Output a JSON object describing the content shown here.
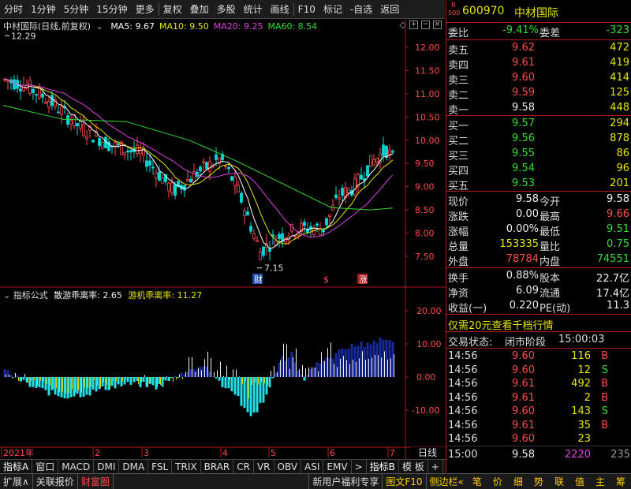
{
  "toolbar": {
    "items": [
      "分时",
      "1分钟",
      "5分钟",
      "15分钟",
      "更多",
      "复权",
      "叠加",
      "多股",
      "统计",
      "画线",
      "F10",
      "标记",
      "-自选",
      "返回"
    ]
  },
  "chart": {
    "title": "中材国际(日线,前复权)",
    "ma": [
      {
        "label": "MA5: 9.67",
        "color": "#ffffff"
      },
      {
        "label": "MA10: 9.50",
        "color": "#e6e600"
      },
      {
        "label": "MA20: 9.25",
        "color": "#e040e0"
      },
      {
        "label": "MA60: 8.54",
        "color": "#33dd33"
      }
    ],
    "high_marker": "12.29",
    "low_marker": "7.15",
    "price_axis": [
      "12.00",
      "11.50",
      "11.00",
      "10.50",
      "10.00",
      "9.50",
      "9.00",
      "8.50",
      "8.00",
      "7.50"
    ],
    "events": [
      "财",
      "$",
      "涨"
    ]
  },
  "indicator": {
    "name": "指标公式",
    "line1": "散游乖离率: 2.65",
    "line2": "游机乖离率: 11.27",
    "axis": [
      "20.00",
      "10.00",
      "0.00",
      "-10.00"
    ]
  },
  "x_axis": {
    "labels": [
      "2021年",
      "2",
      "3",
      "4",
      "5",
      "6",
      "7"
    ],
    "period": "日线"
  },
  "tabs": [
    "指标A",
    "窗口",
    "MACD",
    "DMI",
    "DMA",
    "FSL",
    "TRIX",
    "BRAR",
    "CR",
    "VR",
    "OBV",
    "ASI",
    "EMV",
    ">",
    "指标B",
    "模 板",
    "+",
    "-"
  ],
  "status_bar": {
    "left": [
      "扩展∧",
      "关联报价",
      "财富圈"
    ],
    "right": [
      "新用户福利专享",
      "图文F10",
      "侧边栏«"
    ],
    "icons": [
      "笔",
      "价",
      "细",
      "势",
      "联",
      "值",
      "主",
      "筹"
    ]
  },
  "quote": {
    "code": "600970",
    "name": "中材国际",
    "badge_top": "R",
    "badge_bottom": "500",
    "webi_label": "委比",
    "webi": "-9.41%",
    "weicha_label": "委差",
    "weicha": "-323",
    "asks": [
      {
        "label": "卖五",
        "price": "9.62",
        "vol": "472"
      },
      {
        "label": "卖四",
        "price": "9.61",
        "vol": "419"
      },
      {
        "label": "卖三",
        "price": "9.60",
        "vol": "414"
      },
      {
        "label": "卖二",
        "price": "9.59",
        "vol": "125"
      },
      {
        "label": "卖一",
        "price": "9.58",
        "vol": "448"
      }
    ],
    "bids": [
      {
        "label": "买一",
        "price": "9.57",
        "vol": "294"
      },
      {
        "label": "买二",
        "price": "9.56",
        "vol": "878"
      },
      {
        "label": "买三",
        "price": "9.55",
        "vol": "86"
      },
      {
        "label": "买四",
        "price": "9.54",
        "vol": "96"
      },
      {
        "label": "买五",
        "price": "9.53",
        "vol": "201"
      }
    ],
    "stats": [
      {
        "l1": "现价",
        "v1": "9.58",
        "c1": "white",
        "l2": "今开",
        "v2": "9.58",
        "c2": "white"
      },
      {
        "l1": "涨跌",
        "v1": "0.00",
        "c1": "white",
        "l2": "最高",
        "v2": "9.66",
        "c2": "red"
      },
      {
        "l1": "涨幅",
        "v1": "0.00%",
        "c1": "white",
        "l2": "最低",
        "v2": "9.51",
        "c2": "green"
      },
      {
        "l1": "总量",
        "v1": "153335",
        "c1": "yellow",
        "l2": "量比",
        "v2": "0.75",
        "c2": "green"
      },
      {
        "l1": "外盘",
        "v1": "78784",
        "c1": "red",
        "l2": "内盘",
        "v2": "74551",
        "c2": "green"
      }
    ],
    "stats2": [
      {
        "l1": "换手",
        "v1": "0.88%",
        "l2": "股本",
        "v2": "22.7亿"
      },
      {
        "l1": "净资",
        "v1": "6.09",
        "l2": "流通",
        "v2": "17.4亿"
      },
      {
        "l1": "收益(一)",
        "v1": "0.220",
        "l2": "PE(动)",
        "v2": "11.3"
      }
    ],
    "promo": "仅需20元查看千档行情",
    "trade_status_label": "交易状态:",
    "trade_status": "闭市阶段",
    "trade_time": "15:00:03",
    "ticks": [
      {
        "time": "14:56",
        "price": "9.60",
        "vol": "116",
        "side": "B"
      },
      {
        "time": "14:56",
        "price": "9.60",
        "vol": "12",
        "side": "S"
      },
      {
        "time": "14:56",
        "price": "9.61",
        "vol": "492",
        "side": "B"
      },
      {
        "time": "14:56",
        "price": "9.61",
        "vol": "2",
        "side": "B"
      },
      {
        "time": "14:56",
        "price": "9.60",
        "vol": "143",
        "side": "S"
      },
      {
        "time": "14:56",
        "price": "9.61",
        "vol": "35",
        "side": "B"
      },
      {
        "time": "14:56",
        "price": "9.60",
        "vol": "23",
        "side": ""
      }
    ],
    "last_tick": {
      "time": "15:00",
      "price": "9.58",
      "vol": "2220",
      "extra": "235"
    }
  },
  "colors": {
    "up": "#ff4b4b",
    "down": "#00d8d8",
    "border": "#b01818",
    "ma5": "#ffffff",
    "ma10": "#e6e600",
    "ma20": "#e040e0",
    "ma60": "#33dd33"
  }
}
